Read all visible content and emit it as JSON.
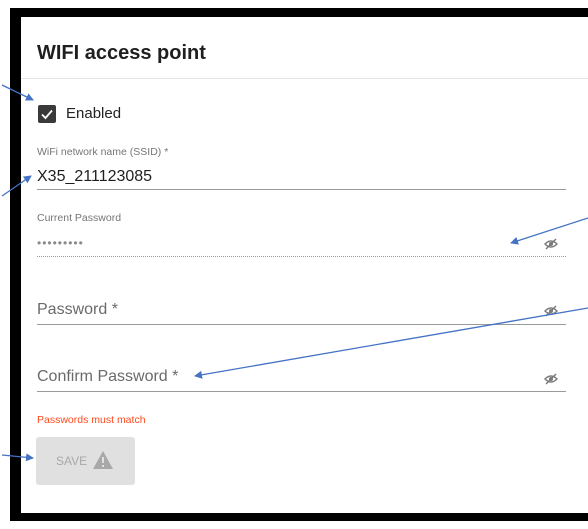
{
  "card": {
    "title": "WIFI access point"
  },
  "enabled": {
    "label": "Enabled",
    "checked": true
  },
  "ssid": {
    "label": "WiFi network name (SSID) *",
    "value": "X35_211123085"
  },
  "current_password": {
    "label": "Current Password",
    "masked_value": "•••••••••",
    "icon": "eye-off-icon"
  },
  "password": {
    "placeholder": "Password *",
    "icon": "eye-off-icon"
  },
  "confirm_password": {
    "placeholder": "Confirm Password *",
    "icon": "eye-off-icon"
  },
  "error": {
    "text": "Passwords must match",
    "color": "#ff4a1c"
  },
  "save_button": {
    "label": "SAVE",
    "icon": "warning-icon",
    "disabled": true
  },
  "colors": {
    "arrow": "#4472c4",
    "frame": "#000000"
  }
}
